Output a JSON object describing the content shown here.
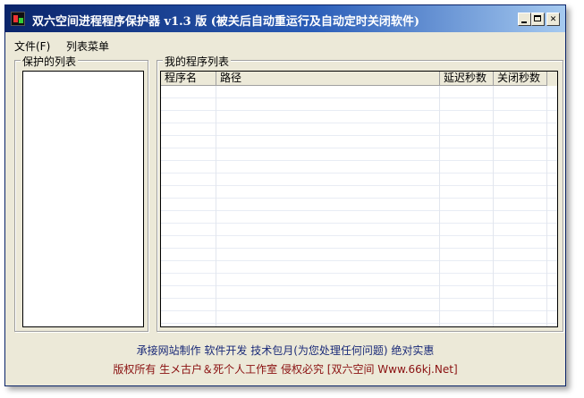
{
  "window": {
    "title": "双六空间进程程序保护器 v1.3 版 (被关后自动重运行及自动定时关闭软件)"
  },
  "menu": {
    "file": "文件(F)",
    "list_menu": "列表菜单"
  },
  "left_panel": {
    "title": "保护的列表"
  },
  "right_panel": {
    "title": "我的程序列表",
    "columns": [
      "程序名",
      "路径",
      "延迟秒数",
      "关闭秒数"
    ]
  },
  "footer": {
    "line1": "承接网站制作 软件开发 技术包月(为您处理任何问题) 绝对实惠",
    "line2": "版权所有 生メ古户＆死个人工作室 侵权必究 [双六空间 Www.66kj.Net]"
  },
  "colors": {
    "title_start": "#0a246a",
    "title_end": "#a6caf0",
    "footer_line1": "#1a2a78",
    "footer_line2": "#8a1010"
  }
}
